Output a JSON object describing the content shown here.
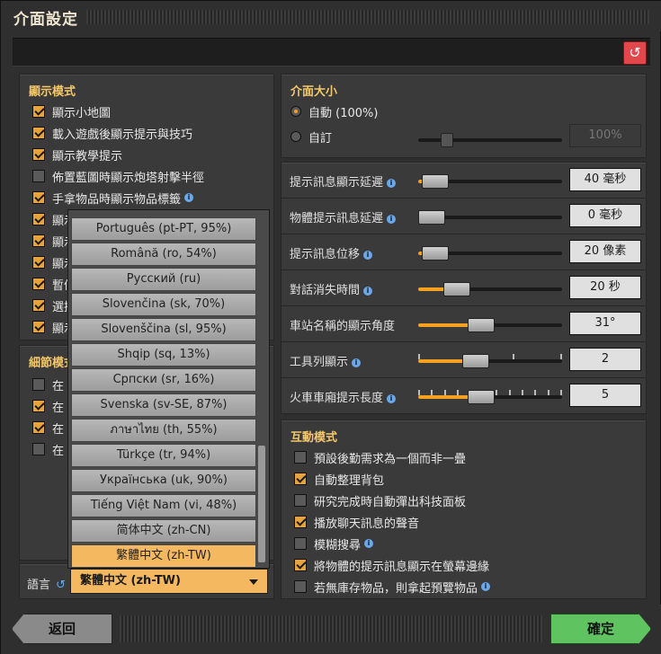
{
  "window": {
    "title": "介面設定"
  },
  "toolbar": {
    "reset_icon": "reset-icon"
  },
  "display_mode": {
    "title": "顯示模式",
    "items": [
      {
        "label": "顯示小地圖",
        "checked": true,
        "info": false
      },
      {
        "label": "載入遊戲後顯示提示與技巧",
        "checked": true,
        "info": false
      },
      {
        "label": "顯示教學提示",
        "checked": true,
        "info": false
      },
      {
        "label": "佈置藍圖時顯示炮塔射擊半徑",
        "checked": false,
        "info": false
      },
      {
        "label": "手拿物品時顯示物品標籤",
        "checked": true,
        "info": true
      },
      {
        "label": "顯示",
        "checked": true,
        "info": false
      },
      {
        "label": "顯示",
        "checked": true,
        "info": false
      },
      {
        "label": "顯示",
        "checked": true,
        "info": false
      },
      {
        "label": "暫停",
        "checked": true,
        "info": false
      },
      {
        "label": "選擇",
        "checked": true,
        "info": false
      },
      {
        "label": "顯示",
        "checked": true,
        "info": false
      }
    ]
  },
  "detail_mode": {
    "title": "細節模式",
    "items": [
      {
        "label": "在「",
        "checked": false
      },
      {
        "label": "在「",
        "checked": true
      },
      {
        "label": "在「",
        "checked": true
      },
      {
        "label": "在「",
        "checked": false
      }
    ]
  },
  "language": {
    "label": "語言",
    "selected": "繁體中文 (zh-TW)",
    "options": [
      "Português (pt-PT, 95%)",
      "Română (ro, 54%)",
      "Русский (ru)",
      "Slovenčina (sk, 70%)",
      "Slovenščina (sl, 95%)",
      "Shqip (sq, 13%)",
      "Српски (sr, 16%)",
      "Svenska (sv-SE, 87%)",
      "ภาษาไทย (th, 55%)",
      "Türkçe (tr, 94%)",
      "Українська (uk, 90%)",
      "Tiếng Việt Nam (vi, 48%)",
      "简体中文 (zh-CN)",
      "繁體中文 (zh-TW)"
    ]
  },
  "ui_scale": {
    "title": "介面大小",
    "auto_label": "自動 (100%)",
    "custom_label": "自訂",
    "custom_value": "100%"
  },
  "sliders": [
    {
      "label": "提示訊息顯示延遲",
      "info": true,
      "value": "40 毫秒",
      "level": 0.05
    },
    {
      "label": "物體提示訊息延遲",
      "info": true,
      "value": "0 毫秒",
      "level": 0.0
    },
    {
      "label": "提示訊息位移",
      "info": true,
      "value": "20 像素",
      "level": 0.05
    },
    {
      "label": "對話消失時間",
      "info": true,
      "value": "20 秒",
      "level": 0.2
    },
    {
      "label": "車站名稱的顯示角度",
      "info": false,
      "value": "31°",
      "level": 0.37
    },
    {
      "label": "工具列顯示",
      "info": true,
      "value": "2",
      "level": 0.33
    },
    {
      "label": "火車車廂提示長度",
      "info": true,
      "value": "5",
      "level": 0.37
    }
  ],
  "interaction": {
    "title": "互動模式",
    "items": [
      {
        "label": "預設後勤需求為一個而非一疊",
        "checked": false,
        "info": false
      },
      {
        "label": "自動整理背包",
        "checked": true,
        "info": false
      },
      {
        "label": "研究完成時自動彈出科技面板",
        "checked": false,
        "info": false
      },
      {
        "label": "播放聊天訊息的聲音",
        "checked": true,
        "info": false
      },
      {
        "label": "模糊搜尋",
        "checked": false,
        "info": true
      },
      {
        "label": "將物體的提示訊息顯示在螢幕邊緣",
        "checked": true,
        "info": false
      },
      {
        "label": "若無庫存物品，則拿起預覽物品",
        "checked": false,
        "info": true
      }
    ]
  },
  "footer": {
    "back_label": "返回",
    "confirm_label": "確定"
  }
}
